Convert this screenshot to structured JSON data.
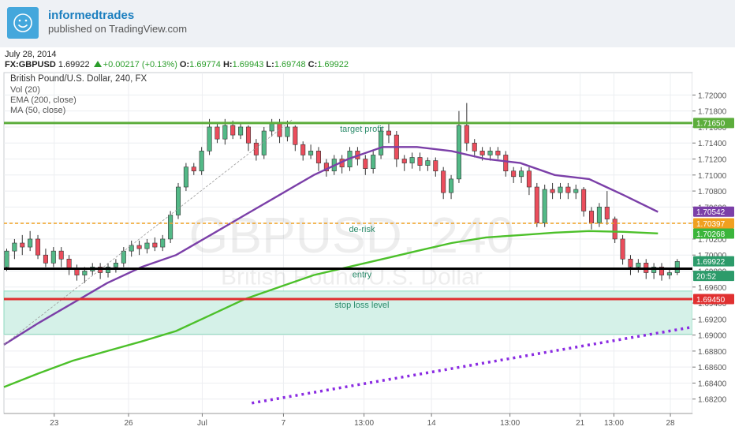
{
  "header": {
    "author": "informedtrades",
    "published": "published on TradingView.com"
  },
  "quote": {
    "date": "July 28, 2014",
    "symbol": "FX:GBPUSD",
    "last": "1.69922",
    "change": "+0.00217 (+0.13%)",
    "open_label": "O:",
    "open": "1.69774",
    "high_label": "H:",
    "high": "1.69943",
    "low_label": "L:",
    "low": "1.69748",
    "close_label": "C:",
    "close": "1.69922"
  },
  "chart_data": {
    "type": "candlestick",
    "title": "British Pound/U.S. Dollar, 240, FX",
    "indicators": [
      "Vol (20)",
      "EMA (200, close)",
      "MA (50, close)"
    ],
    "watermark_symbol": "GBPUSD, 240",
    "watermark_name": "British Pound/U.S. Dollar",
    "ylim": [
      1.6802,
      1.7228
    ],
    "y_ticks": [
      1.72,
      1.718,
      1.716,
      1.714,
      1.712,
      1.71,
      1.708,
      1.706,
      1.704,
      1.702,
      1.7,
      1.698,
      1.696,
      1.694,
      1.692,
      1.69,
      1.688,
      1.686,
      1.684,
      1.682
    ],
    "y_tick_labels": [
      "1.72000",
      "1.71800",
      "1.71600",
      "1.71400",
      "1.71200",
      "1.71000",
      "1.70800",
      "1.70600",
      "1.70400",
      "1.70200",
      "1.70000",
      "1.69800",
      "1.69600",
      "1.69400",
      "1.69200",
      "1.69000",
      "1.68800",
      "1.68600",
      "1.68400",
      "1.68200"
    ],
    "x_ticks": [
      {
        "label": "23",
        "pos": 0.073
      },
      {
        "label": "26",
        "pos": 0.181
      },
      {
        "label": "Jul",
        "pos": 0.288
      },
      {
        "label": "7",
        "pos": 0.406
      },
      {
        "label": "13:00",
        "pos": 0.523
      },
      {
        "label": "14",
        "pos": 0.621
      },
      {
        "label": "13:00",
        "pos": 0.735
      },
      {
        "label": "21",
        "pos": 0.837
      },
      {
        "label": "13:00",
        "pos": 0.886
      },
      {
        "label": "28",
        "pos": 0.968
      }
    ],
    "levels": [
      {
        "name": "target profit",
        "value": 1.7165,
        "color": "#5cad3c",
        "label": "1.71650",
        "text": "target profit"
      },
      {
        "name": "de-risk",
        "value": 1.70397,
        "color": "#f0a020",
        "label": "1.70397",
        "text": "de-risk"
      },
      {
        "name": "entry",
        "value": 1.6983,
        "color": "#000000",
        "label": "",
        "text": "entry"
      },
      {
        "name": "stop loss level",
        "value": 1.6945,
        "color": "#e03030",
        "label": "1.69450",
        "text": "stop loss level"
      }
    ],
    "zone": {
      "top": 1.6955,
      "bottom": 1.6901,
      "color": "#d5f1e8"
    },
    "price_tags": [
      {
        "label": "1.71650",
        "value": 1.7165,
        "bg": "#5cad3c"
      },
      {
        "label": "1.70542",
        "value": 1.70542,
        "bg": "#7b3fa8"
      },
      {
        "label": "1.70397",
        "value": 1.70397,
        "bg": "#f0a020"
      },
      {
        "label": "1.70268",
        "value": 1.70268,
        "bg": "#3bb53b"
      },
      {
        "label": "1.69922",
        "value": 1.69922,
        "bg": "#2c9b6a"
      },
      {
        "label": "20:52",
        "value": 1.6974,
        "bg": "#2c9b6a"
      },
      {
        "label": "1.69450",
        "value": 1.6945,
        "bg": "#e03030"
      }
    ],
    "ma50": [
      [
        0.0,
        1.6888
      ],
      [
        0.05,
        1.6915
      ],
      [
        0.1,
        1.694
      ],
      [
        0.15,
        1.6965
      ],
      [
        0.2,
        1.6985
      ],
      [
        0.25,
        1.7
      ],
      [
        0.3,
        1.7025
      ],
      [
        0.35,
        1.705
      ],
      [
        0.4,
        1.7075
      ],
      [
        0.45,
        1.71
      ],
      [
        0.5,
        1.712
      ],
      [
        0.55,
        1.7135
      ],
      [
        0.6,
        1.7135
      ],
      [
        0.65,
        1.713
      ],
      [
        0.7,
        1.712
      ],
      [
        0.75,
        1.7115
      ],
      [
        0.8,
        1.71
      ],
      [
        0.85,
        1.7095
      ],
      [
        0.9,
        1.7075
      ],
      [
        0.95,
        1.7054
      ]
    ],
    "ema200": [
      [
        0.0,
        1.6835
      ],
      [
        0.05,
        1.6852
      ],
      [
        0.1,
        1.6868
      ],
      [
        0.15,
        1.688
      ],
      [
        0.2,
        1.6892
      ],
      [
        0.25,
        1.6905
      ],
      [
        0.3,
        1.6925
      ],
      [
        0.35,
        1.6945
      ],
      [
        0.4,
        1.696
      ],
      [
        0.45,
        1.6975
      ],
      [
        0.5,
        1.6985
      ],
      [
        0.55,
        1.6995
      ],
      [
        0.6,
        1.7005
      ],
      [
        0.65,
        1.7015
      ],
      [
        0.7,
        1.7022
      ],
      [
        0.75,
        1.7025
      ],
      [
        0.8,
        1.7028
      ],
      [
        0.85,
        1.703
      ],
      [
        0.9,
        1.7029
      ],
      [
        0.95,
        1.7027
      ]
    ],
    "trend_dotted": [
      [
        0.36,
        1.6815
      ],
      [
        1.0,
        1.691
      ]
    ],
    "trend_thin": [
      [
        0.0,
        1.6888
      ],
      [
        0.42,
        1.717
      ]
    ],
    "candles": [
      [
        1.6985,
        1.7005,
        1.698,
        1.7008
      ],
      [
        1.7005,
        1.7015,
        1.6995,
        1.702
      ],
      [
        1.7015,
        1.701,
        1.7,
        1.7025
      ],
      [
        1.701,
        1.702,
        1.7005,
        1.703
      ],
      [
        1.702,
        1.7,
        1.6995,
        1.7025
      ],
      [
        1.7,
        1.699,
        1.6985,
        1.7008
      ],
      [
        1.699,
        1.7005,
        1.6985,
        1.701
      ],
      [
        1.7005,
        1.6995,
        1.6985,
        1.701
      ],
      [
        1.6995,
        1.6982,
        1.6975,
        1.7
      ],
      [
        1.6982,
        1.6975,
        1.6968,
        1.6988
      ],
      [
        1.6975,
        1.698,
        1.6965,
        1.6985
      ],
      [
        1.698,
        1.6985,
        1.6975,
        1.699
      ],
      [
        1.6985,
        1.6978,
        1.697,
        1.699
      ],
      [
        1.6978,
        1.6985,
        1.6972,
        1.699
      ],
      [
        1.6985,
        1.699,
        1.6978,
        1.6995
      ],
      [
        1.699,
        1.7005,
        1.6985,
        1.701
      ],
      [
        1.7005,
        1.7012,
        1.6998,
        1.7018
      ],
      [
        1.7012,
        1.7008,
        1.7,
        1.7018
      ],
      [
        1.7008,
        1.7015,
        1.7002,
        1.702
      ],
      [
        1.7015,
        1.701,
        1.7005,
        1.7022
      ],
      [
        1.701,
        1.702,
        1.7005,
        1.7025
      ],
      [
        1.702,
        1.705,
        1.7015,
        1.7055
      ],
      [
        1.705,
        1.7085,
        1.7045,
        1.709
      ],
      [
        1.7085,
        1.711,
        1.708,
        1.7115
      ],
      [
        1.711,
        1.7105,
        1.71,
        1.7115
      ],
      [
        1.7105,
        1.713,
        1.71,
        1.7135
      ],
      [
        1.713,
        1.716,
        1.7125,
        1.717
      ],
      [
        1.716,
        1.7145,
        1.714,
        1.7165
      ],
      [
        1.7145,
        1.7162,
        1.7138,
        1.717
      ],
      [
        1.7162,
        1.715,
        1.7145,
        1.7168
      ],
      [
        1.715,
        1.716,
        1.7145,
        1.7165
      ],
      [
        1.716,
        1.714,
        1.713,
        1.7162
      ],
      [
        1.714,
        1.7125,
        1.7118,
        1.7145
      ],
      [
        1.7125,
        1.7155,
        1.712,
        1.716
      ],
      [
        1.7155,
        1.7165,
        1.7148,
        1.717
      ],
      [
        1.7165,
        1.7148,
        1.714,
        1.717
      ],
      [
        1.7148,
        1.716,
        1.7142,
        1.7168
      ],
      [
        1.716,
        1.7138,
        1.713,
        1.7162
      ],
      [
        1.7138,
        1.7125,
        1.7118,
        1.7142
      ],
      [
        1.7125,
        1.713,
        1.712,
        1.7138
      ],
      [
        1.713,
        1.7115,
        1.7105,
        1.7135
      ],
      [
        1.7115,
        1.7105,
        1.7098,
        1.712
      ],
      [
        1.7105,
        1.712,
        1.71,
        1.7125
      ],
      [
        1.712,
        1.711,
        1.7102,
        1.7125
      ],
      [
        1.711,
        1.713,
        1.7105,
        1.7135
      ],
      [
        1.713,
        1.712,
        1.7112,
        1.7135
      ],
      [
        1.712,
        1.7108,
        1.71,
        1.7125
      ],
      [
        1.7108,
        1.7125,
        1.7102,
        1.713
      ],
      [
        1.7125,
        1.7155,
        1.712,
        1.716
      ],
      [
        1.7155,
        1.715,
        1.714,
        1.7165
      ],
      [
        1.715,
        1.712,
        1.711,
        1.7155
      ],
      [
        1.712,
        1.7115,
        1.7105,
        1.7125
      ],
      [
        1.7115,
        1.7122,
        1.7108,
        1.7128
      ],
      [
        1.7122,
        1.7112,
        1.7105,
        1.7128
      ],
      [
        1.7112,
        1.7118,
        1.7105,
        1.7122
      ],
      [
        1.7118,
        1.7105,
        1.7098,
        1.7122
      ],
      [
        1.7105,
        1.7078,
        1.707,
        1.711
      ],
      [
        1.7078,
        1.7095,
        1.707,
        1.71
      ],
      [
        1.7095,
        1.7162,
        1.709,
        1.718
      ],
      [
        1.7162,
        1.714,
        1.713,
        1.719
      ],
      [
        1.714,
        1.713,
        1.7122,
        1.7145
      ],
      [
        1.713,
        1.7125,
        1.7118,
        1.7135
      ],
      [
        1.7125,
        1.713,
        1.7118,
        1.7135
      ],
      [
        1.713,
        1.7125,
        1.712,
        1.7135
      ],
      [
        1.7125,
        1.7105,
        1.7098,
        1.713
      ],
      [
        1.7105,
        1.7098,
        1.709,
        1.711
      ],
      [
        1.7098,
        1.7105,
        1.709,
        1.711
      ],
      [
        1.7105,
        1.7085,
        1.7075,
        1.711
      ],
      [
        1.7085,
        1.704,
        1.7035,
        1.709
      ],
      [
        1.704,
        1.7082,
        1.7035,
        1.7088
      ],
      [
        1.7082,
        1.7078,
        1.707,
        1.709
      ],
      [
        1.7078,
        1.7085,
        1.707,
        1.709
      ],
      [
        1.7085,
        1.7078,
        1.707,
        1.709
      ],
      [
        1.7078,
        1.7082,
        1.707,
        1.7088
      ],
      [
        1.7082,
        1.7055,
        1.7048,
        1.7085
      ],
      [
        1.7055,
        1.704,
        1.7032,
        1.706
      ],
      [
        1.704,
        1.706,
        1.7035,
        1.7065
      ],
      [
        1.706,
        1.7045,
        1.7038,
        1.708
      ],
      [
        1.7045,
        1.702,
        1.7015,
        1.7048
      ],
      [
        1.702,
        1.6995,
        1.6988,
        1.7025
      ],
      [
        1.6995,
        1.6985,
        1.6975,
        1.7
      ],
      [
        1.6985,
        1.699,
        1.6978,
        1.6995
      ],
      [
        1.699,
        1.6978,
        1.697,
        1.6995
      ],
      [
        1.6978,
        1.6985,
        1.697,
        1.699
      ],
      [
        1.6985,
        1.6975,
        1.6968,
        1.699
      ],
      [
        1.6975,
        1.6978,
        1.697,
        1.6982
      ],
      [
        1.6978,
        1.6992,
        1.6975,
        1.6995
      ]
    ]
  }
}
